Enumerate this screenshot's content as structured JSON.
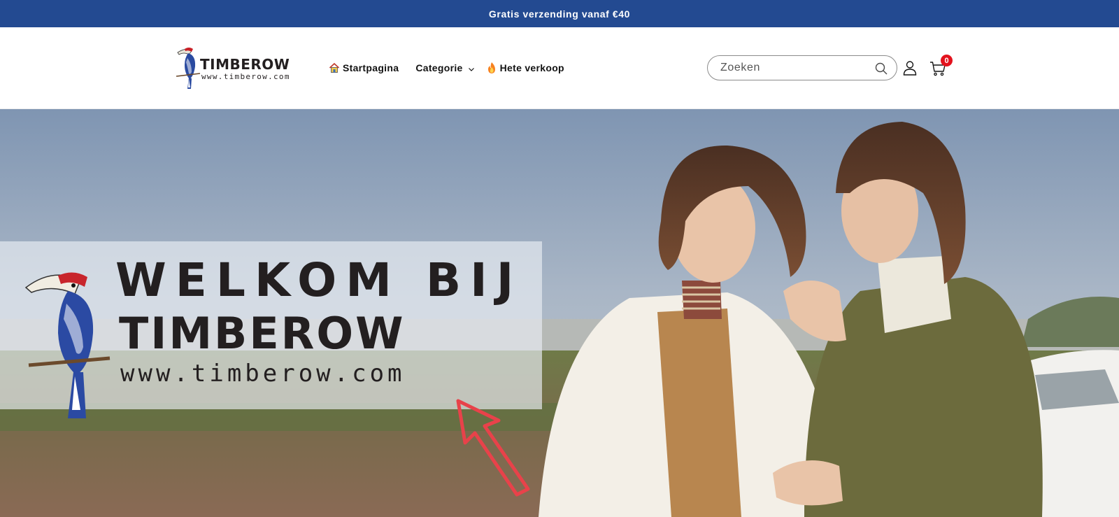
{
  "announcement": {
    "text": "Gratis verzending vanaf €40"
  },
  "header": {
    "logo": {
      "name": "TIMBEROW",
      "url": "www.timberow.com"
    },
    "nav": {
      "home_label": "Startpagina",
      "category_label": "Categorie",
      "hot_label": "Hete verkoop"
    },
    "search": {
      "placeholder": "Zoeken",
      "value": ""
    },
    "cart": {
      "count": "0"
    }
  },
  "hero": {
    "welcome_line1": "WELKOM BIJ",
    "welcome_line2": "TIMBEROW",
    "welcome_url": "www.timberow.com"
  },
  "icons": {
    "home": "home-icon",
    "category_dropdown": "chevron-down-icon",
    "hot": "flame-icon",
    "search": "search-icon",
    "account": "user-icon",
    "cart": "cart-icon"
  },
  "colors": {
    "announcement_bg": "#234a91",
    "cart_badge": "#e3121d",
    "text": "#121212",
    "arrow": "#e8424a"
  }
}
